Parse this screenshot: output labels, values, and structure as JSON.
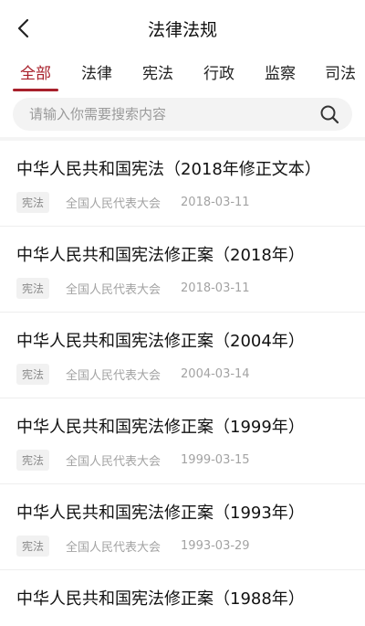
{
  "header": {
    "title": "法律法规"
  },
  "tabs": [
    {
      "label": "全部"
    },
    {
      "label": "法律"
    },
    {
      "label": "宪法"
    },
    {
      "label": "行政"
    },
    {
      "label": "监察"
    },
    {
      "label": "司法"
    }
  ],
  "search": {
    "placeholder": "请输入你需要搜索内容"
  },
  "colors": {
    "accent": "#a8202b"
  },
  "items": [
    {
      "title": "中华人民共和国宪法（2018年修正文本）",
      "tag": "宪法",
      "source": "全国人民代表大会",
      "date": "2018-03-11"
    },
    {
      "title": "中华人民共和国宪法修正案（2018年）",
      "tag": "宪法",
      "source": "全国人民代表大会",
      "date": "2018-03-11"
    },
    {
      "title": "中华人民共和国宪法修正案（2004年）",
      "tag": "宪法",
      "source": "全国人民代表大会",
      "date": "2004-03-14"
    },
    {
      "title": "中华人民共和国宪法修正案（1999年）",
      "tag": "宪法",
      "source": "全国人民代表大会",
      "date": "1999-03-15"
    },
    {
      "title": "中华人民共和国宪法修正案（1993年）",
      "tag": "宪法",
      "source": "全国人民代表大会",
      "date": "1993-03-29"
    },
    {
      "title": "中华人民共和国宪法修正案（1988年）",
      "tag": "",
      "source": "",
      "date": ""
    }
  ]
}
